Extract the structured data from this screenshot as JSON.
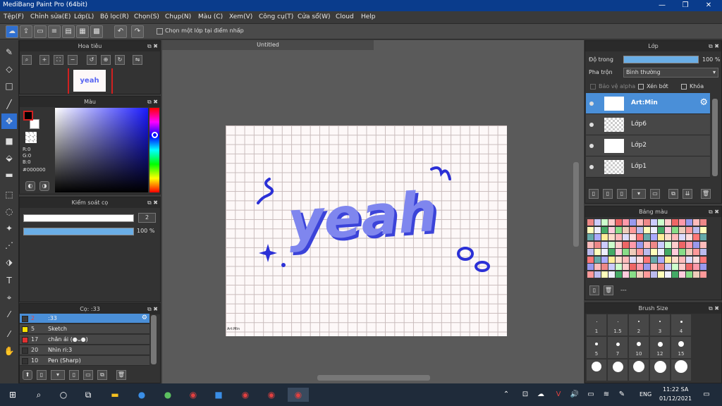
{
  "window": {
    "title": "MediBang Paint Pro (64bit)",
    "min": "—",
    "max": "❐",
    "close": "✕"
  },
  "menu": [
    "Tệp(F)",
    "Chỉnh sửa(E)",
    "Lớp(L)",
    "Bộ lọc(R)",
    "Chọn(S)",
    "Chụp(N)",
    "Màu (C)",
    "Xem(V)",
    "Công cụ(T)",
    "Cửa sổ(W)",
    "Cloud",
    "Help"
  ],
  "toolbar": {
    "checkbox_label": "Chọn một lớp tại điểm nhấp",
    "undo": "↶",
    "redo": "↷"
  },
  "navigator": {
    "title": "Hoa tiêu",
    "thumb_text": "yeah"
  },
  "color": {
    "title": "Màu",
    "r": "R:0",
    "g": "G:0",
    "b": "B:0",
    "hex": "#000000",
    "primary": "#000000"
  },
  "brush_control": {
    "title": "Kiểm soát cọ",
    "size": "2",
    "opacity": "100 %"
  },
  "brush_list": {
    "title": "Cọ: :33",
    "items": [
      {
        "num": "2",
        "label": ":33",
        "color": "#3a3a3a",
        "selected": true
      },
      {
        "num": "5",
        "label": "Sketch",
        "color": "#f5e000"
      },
      {
        "num": "17",
        "label": "chân ái (●ᴗ●)",
        "color": "#e03030"
      },
      {
        "num": "20",
        "label": "Nhìn ri:3",
        "color": "#333333"
      },
      {
        "num": "10",
        "label": "Pen (Sharp)",
        "color": "#333333"
      }
    ]
  },
  "canvas": {
    "tab": "Untitled",
    "art": "yeah",
    "signature": "Art:Min"
  },
  "layers": {
    "title": "Lớp",
    "opacity_label": "Độ trong",
    "opacity_value": "100 %",
    "blend_label": "Pha trộn",
    "blend_value": "Bình thường",
    "protect_alpha": "Bảo vệ alpha",
    "clip": "Xén bớt",
    "lock": "Khóa",
    "items": [
      {
        "name": "Art:Min",
        "selected": true
      },
      {
        "name": "Lớp6"
      },
      {
        "name": "Lớp2"
      },
      {
        "name": "Lớp1"
      }
    ]
  },
  "palette": {
    "title": "Bảng màu",
    "footer": "---"
  },
  "brush_size": {
    "title": "Brush Size",
    "labels": [
      "1",
      "1.5",
      "2",
      "3",
      "4",
      "5",
      "7",
      "10",
      "12",
      "15"
    ]
  },
  "taskbar": {
    "lang": "ENG",
    "time": "11:22 SA",
    "date": "01/12/2021"
  }
}
